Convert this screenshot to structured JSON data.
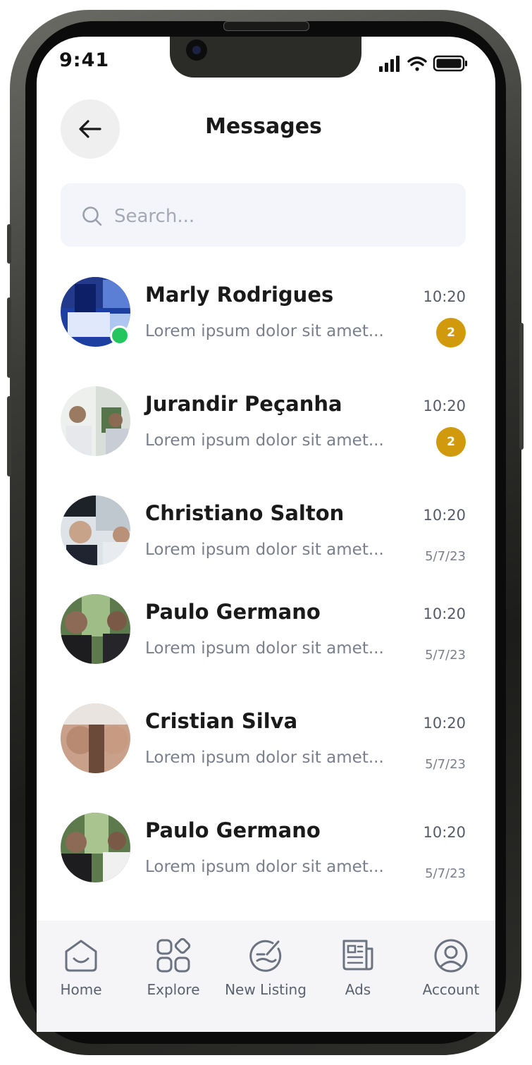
{
  "status_bar": {
    "time": "9:41"
  },
  "header": {
    "title": "Messages"
  },
  "search": {
    "placeholder": "Search..."
  },
  "conversations": [
    {
      "name": "Marly Rodrigues",
      "preview": "Lorem ipsum dolor sit amet...",
      "time": "10:20",
      "unread": "2",
      "online": true
    },
    {
      "name": "Jurandir Peçanha",
      "preview": "Lorem ipsum dolor sit amet...",
      "time": "10:20",
      "unread": "2"
    },
    {
      "name": "Christiano Salton",
      "preview": "Lorem ipsum dolor sit amet...",
      "time": "10:20",
      "date": "5/7/23"
    },
    {
      "name": "Paulo Germano",
      "preview": "Lorem ipsum dolor sit amet...",
      "time": "10:20",
      "date": "5/7/23"
    },
    {
      "name": "Cristian Silva",
      "preview": "Lorem ipsum dolor sit amet...",
      "time": "10:20",
      "date": "5/7/23"
    },
    {
      "name": "Paulo Germano",
      "preview": "Lorem ipsum dolor sit amet...",
      "time": "10:20",
      "date": "5/7/23"
    }
  ],
  "tab_bar": [
    {
      "label": "Home",
      "icon": "home-icon"
    },
    {
      "label": "Explore",
      "icon": "explore-icon"
    },
    {
      "label": "New Listing",
      "icon": "new-listing-icon"
    },
    {
      "label": "Ads",
      "icon": "ads-icon"
    },
    {
      "label": "Account",
      "icon": "account-icon"
    }
  ],
  "colors": {
    "online": "#22c55e",
    "badge": "#d19a0d",
    "search_bg": "#f4f5fa",
    "tab_bar_bg": "#f5f5f7"
  }
}
